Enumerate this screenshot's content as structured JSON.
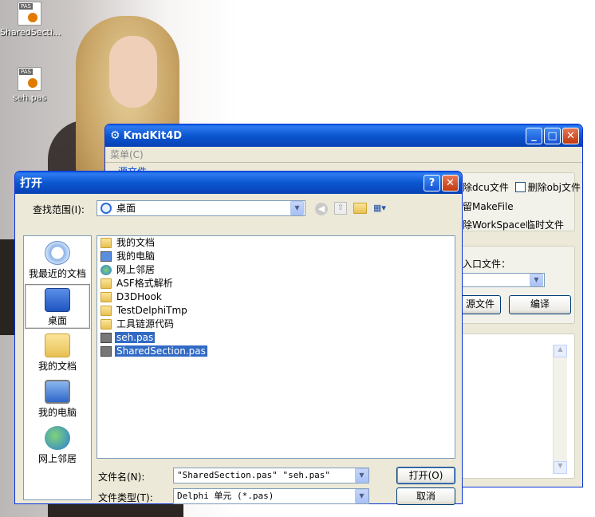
{
  "desktop": {
    "icons": [
      {
        "label": "SharedSecti...",
        "icon": "pas-file-icon"
      },
      {
        "label": "seh.pas",
        "icon": "pas-file-icon"
      }
    ]
  },
  "kmdkit": {
    "title": "KmdKit4D",
    "menu": "菜单(C)",
    "group_label": "源文件",
    "opt_del_dcu": "除dcu文件",
    "opt_del_obj": "删除obj文件",
    "opt_makefile": "留MakeFile",
    "opt_workspace": "除WorkSpace临时文件",
    "entry_label": "入口文件：",
    "source_button": "源文件",
    "compile_button": "编译"
  },
  "dialog": {
    "title": "打开",
    "lookin_label": "查找范围(I):",
    "lookin_value": "桌面",
    "places": [
      {
        "label": "我最近的文档",
        "icon": "recent-docs-icon"
      },
      {
        "label": "桌面",
        "icon": "desktop-icon"
      },
      {
        "label": "我的文档",
        "icon": "my-documents-icon"
      },
      {
        "label": "我的电脑",
        "icon": "my-computer-icon"
      },
      {
        "label": "网上邻居",
        "icon": "network-places-icon"
      }
    ],
    "files": [
      {
        "name": "我的文档",
        "type": "docs"
      },
      {
        "name": "我的电脑",
        "type": "computer"
      },
      {
        "name": "网上邻居",
        "type": "network"
      },
      {
        "name": "ASF格式解析",
        "type": "folder"
      },
      {
        "name": "D3DHook",
        "type": "folder"
      },
      {
        "name": "TestDelphiTmp",
        "type": "folder"
      },
      {
        "name": "工具链源代码",
        "type": "folder"
      },
      {
        "name": "seh.pas",
        "type": "pas",
        "selected": true
      },
      {
        "name": "SharedSection.pas",
        "type": "pas",
        "selected": true
      }
    ],
    "filename_label": "文件名(N):",
    "filename_value": "\"SharedSection.pas\" \"seh.pas\"",
    "filetype_label": "文件类型(T):",
    "filetype_value": "Delphi 单元 (*.pas)",
    "open_button": "打开(O)",
    "cancel_button": "取消"
  }
}
